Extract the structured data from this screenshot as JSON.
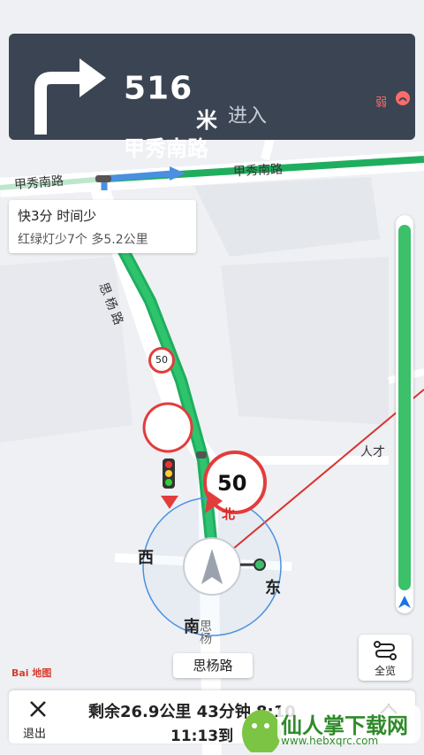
{
  "banner": {
    "distance": "516",
    "distance_unit": "米",
    "action": "进入",
    "road": "甲秀南路",
    "signal_label": "弱"
  },
  "map": {
    "road_top": "甲秀南路",
    "road_top_left": "甲秀南路",
    "road_vertical": "思杨路",
    "road_right": "人才",
    "speed_small": "50",
    "speed_limit": "50",
    "compass_north": "北",
    "compass_west": "西",
    "compass_east": "东",
    "compass_south": "南",
    "south_road_text": "思杨",
    "current_road": "思杨路"
  },
  "route_card": {
    "title": "快3分  时间少",
    "subtitle": "红绿灯少7个  多5.2公里"
  },
  "progress": {
    "fraction": 0.98
  },
  "overview": {
    "label": "全览"
  },
  "bottom": {
    "exit_label": "退出",
    "remaining": "剩余26.9公里  43分钟  8:10",
    "eta": "11:13到"
  },
  "branding": {
    "baidu": "Bai 地图"
  },
  "watermark": {
    "text": "仙人掌下载网",
    "url": "www.hebxqrc.com"
  },
  "colors": {
    "banner_bg": "#3b4452",
    "route_green": "#1fae5e",
    "accent_red": "#e23c3c"
  }
}
